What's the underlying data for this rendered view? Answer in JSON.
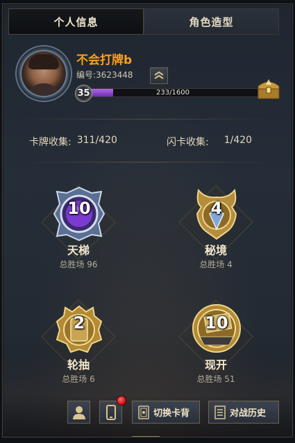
{
  "tabs": [
    {
      "label": "个人信息",
      "active": true
    },
    {
      "label": "角色造型",
      "active": false
    }
  ],
  "profile": {
    "name": "不会打牌b",
    "id_text": "编号:3623448",
    "level": "35",
    "xp_text": "233/1600",
    "xp_fraction": 0.1456
  },
  "collection": {
    "card_label": "卡牌收集:",
    "card_value": "311/420",
    "flash_label": "闪卡收集:",
    "flash_value": "1/420"
  },
  "modes": [
    {
      "key": "ladder",
      "name": "天梯",
      "rank": "10",
      "wins": "总胜场 96"
    },
    {
      "key": "secret",
      "name": "秘境",
      "rank": "4",
      "wins": "总胜场 4"
    },
    {
      "key": "draft",
      "name": "轮抽",
      "rank": "2",
      "wins": "总胜场 6"
    },
    {
      "key": "open",
      "name": "现开",
      "rank": "10",
      "wins": "总胜场 51"
    }
  ],
  "buttons": {
    "swap_card_back": "切换卡背",
    "battle_history": "对战历史"
  },
  "icons": {
    "profile": "person-icon",
    "phone": "phone-icon",
    "card_back": "card-back-icon",
    "history": "history-list-icon",
    "rank": "rank-chevron-icon",
    "chest": "treasure-chest-icon"
  },
  "colors": {
    "name": "#ff9f1a",
    "xp": "#9a4fd6",
    "gold": "#d9b35a",
    "notification": "#d41414"
  }
}
